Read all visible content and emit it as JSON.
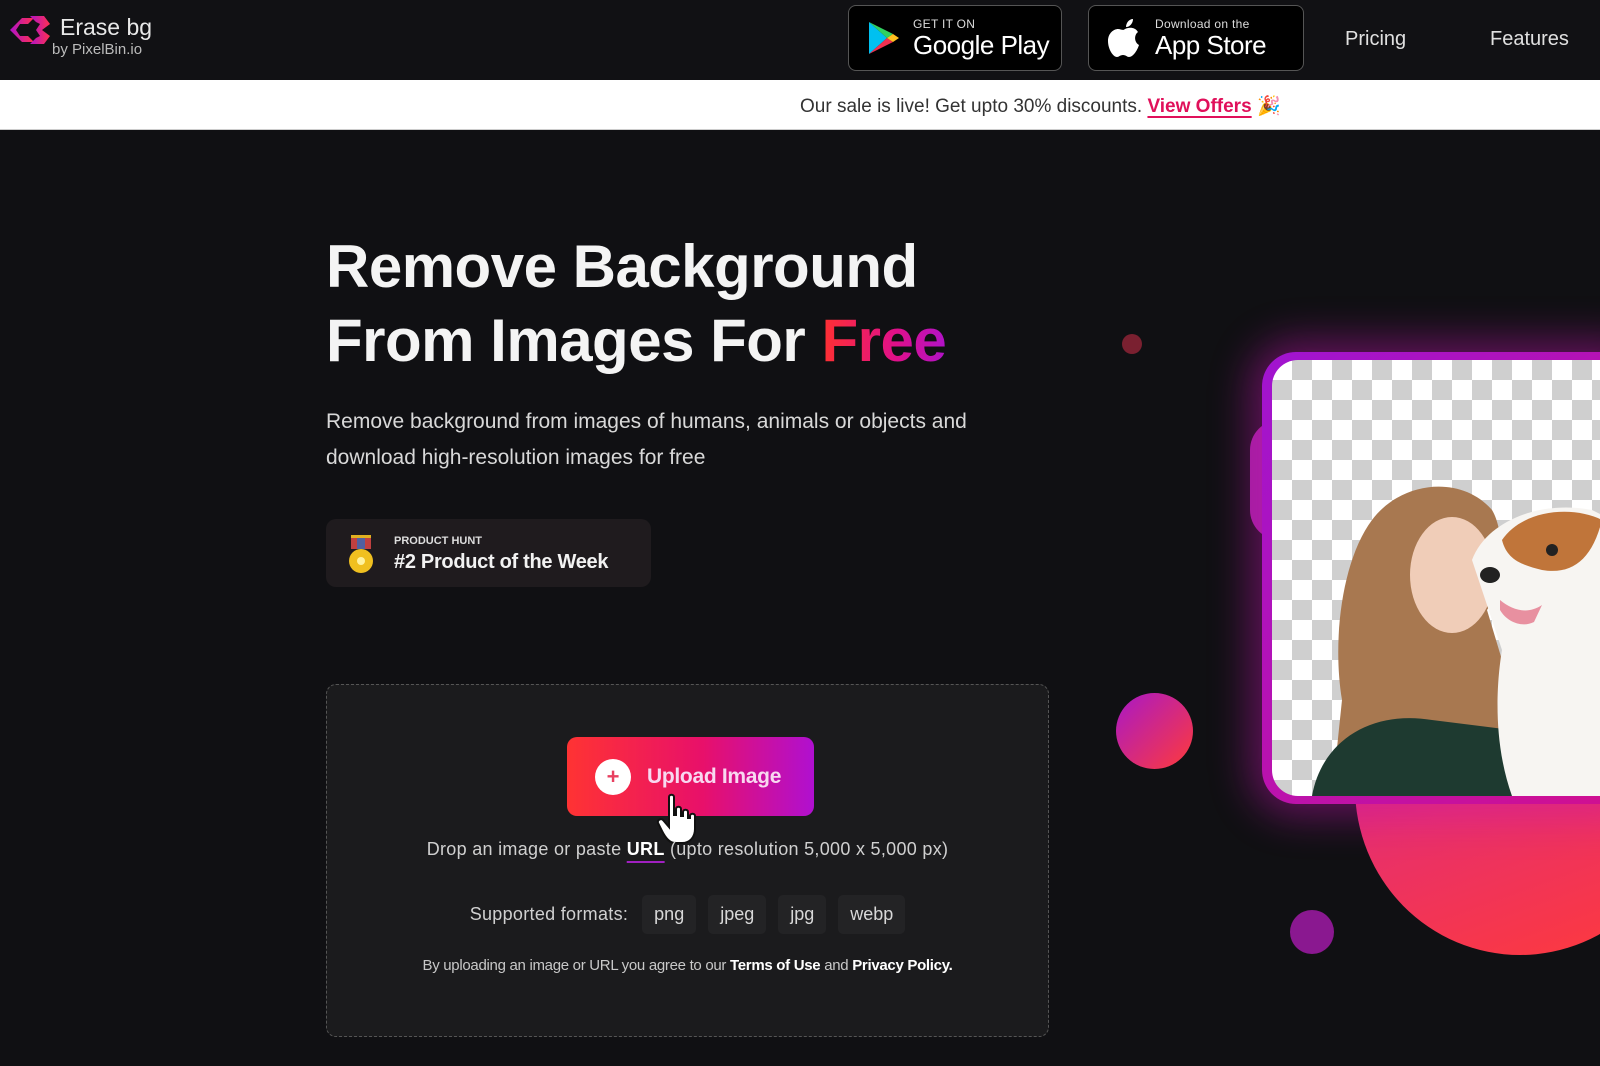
{
  "header": {
    "logo_title": "Erase bg",
    "logo_subtitle": "by PixelBin.io",
    "google_play": {
      "small": "GET IT ON",
      "big": "Google Play"
    },
    "app_store": {
      "small": "Download on the",
      "big": "App Store"
    },
    "nav": [
      {
        "label": "Pricing"
      },
      {
        "label": "Features"
      }
    ]
  },
  "banner": {
    "text": "Our sale is live! Get upto 30% discounts.",
    "link_label": "View Offers",
    "emoji": "🎉"
  },
  "hero": {
    "title_line1": "Remove Background",
    "title_line2_prefix": "From Images For",
    "title_highlight": "Free",
    "subtitle": "Remove background from images of humans, animals or objects and download high-resolution images for free"
  },
  "badge": {
    "small": "PRODUCT HUNT",
    "big": "#2 Product of the Week"
  },
  "upload": {
    "button_label": "Upload Image",
    "drop_prefix": "Drop an image or paste",
    "drop_link": "URL",
    "drop_suffix": "(upto resolution 5,000 x 5,000 px)",
    "formats_label": "Supported formats:",
    "formats": [
      "png",
      "jpeg",
      "jpg",
      "webp"
    ],
    "terms_prefix": "By uploading an image or URL you agree to our",
    "terms_link": "Terms of Use",
    "terms_and": "and",
    "privacy_link": "Privacy Policy."
  },
  "colors": {
    "accent_red": "#ff3333",
    "accent_magenta": "#e8106a",
    "accent_purple": "#b010d0",
    "background": "#101013"
  }
}
